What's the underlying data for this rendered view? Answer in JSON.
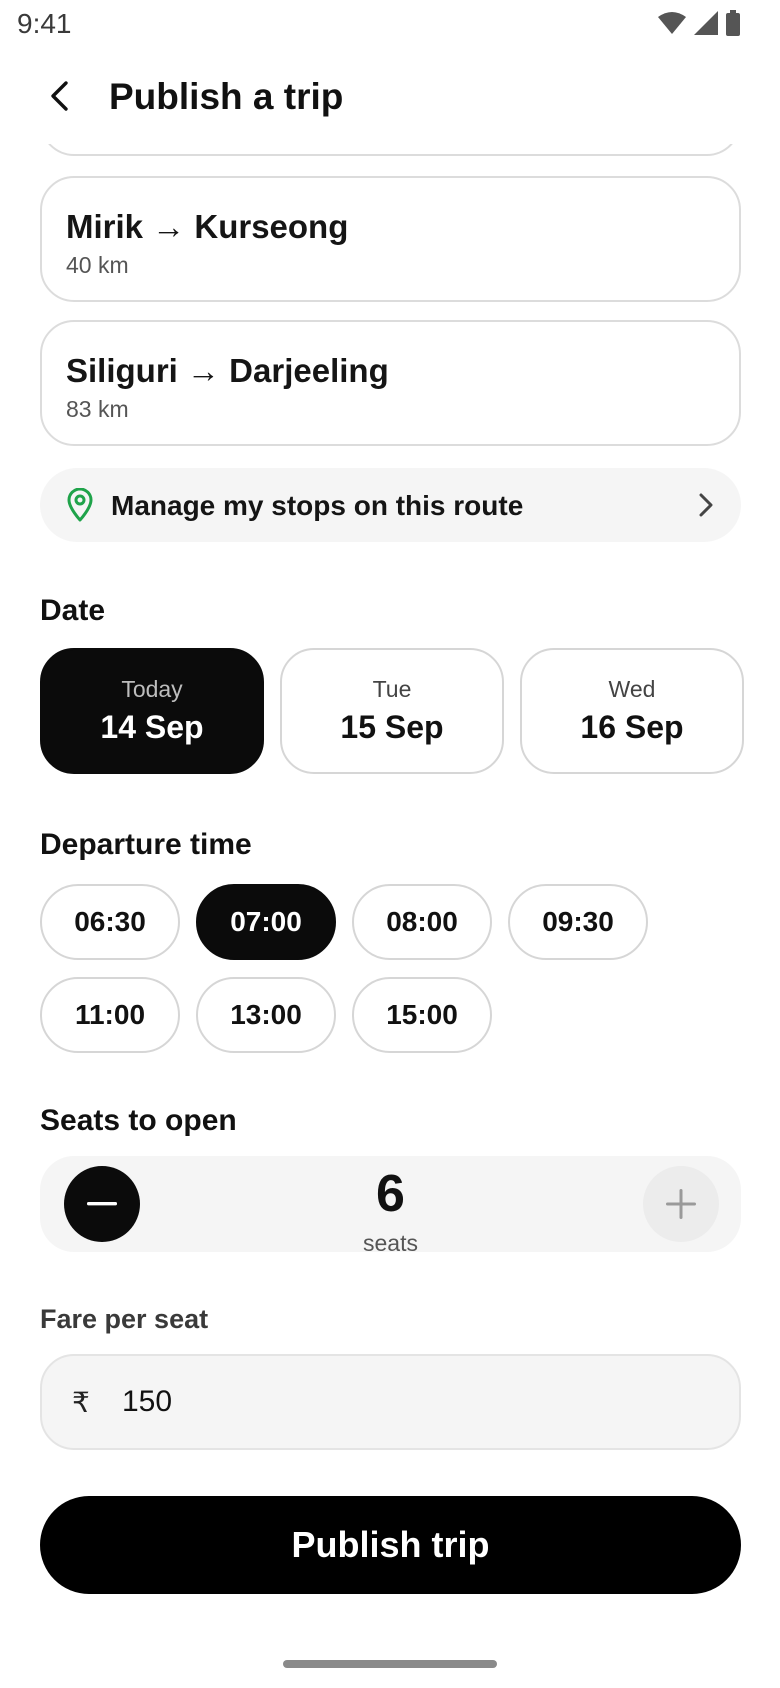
{
  "status_bar": {
    "time": "9:41"
  },
  "header": {
    "title": "Publish a trip"
  },
  "routes": [
    {
      "title": "Mirik → Kurseong",
      "distance": "40 km"
    },
    {
      "title": "Siliguri → Darjeeling",
      "distance": "83 km"
    }
  ],
  "manage_stops": {
    "label": "Manage my stops on this route"
  },
  "date_section": {
    "title": "Date",
    "options": [
      {
        "day": "Today",
        "date": "14 Sep",
        "selected": true
      },
      {
        "day": "Tue",
        "date": "15 Sep",
        "selected": false
      },
      {
        "day": "Wed",
        "date": "16 Sep",
        "selected": false
      }
    ]
  },
  "time_section": {
    "title": "Departure time",
    "options": [
      "06:30",
      "07:00",
      "08:00",
      "09:30",
      "11:00",
      "13:00",
      "15:00"
    ],
    "selected": "07:00"
  },
  "seats_section": {
    "title": "Seats to open",
    "count": "6",
    "unit": "seats"
  },
  "fare": {
    "label": "Fare per seat",
    "currency": "₹",
    "value": "150"
  },
  "publish_button": {
    "label": "Publish trip"
  },
  "colors": {
    "accent": "#0b0b0b",
    "pin": "#1fa34a",
    "surface": "#f5f5f5",
    "border": "#dcdcdc"
  }
}
